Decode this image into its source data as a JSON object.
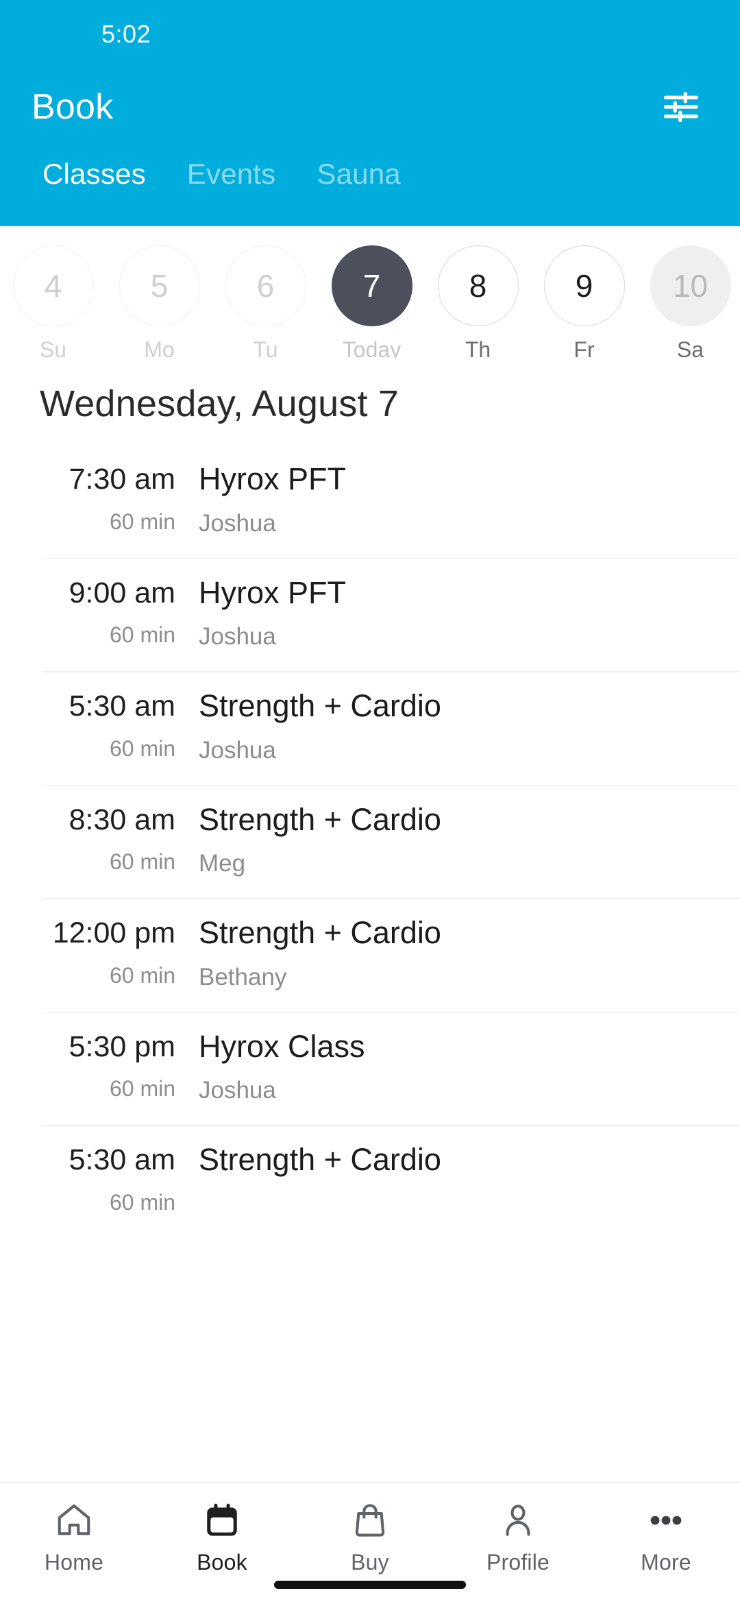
{
  "statusbar": {
    "time": "5:02"
  },
  "header": {
    "title": "Book",
    "accent_color": "#00ADDC",
    "filter_icon": "tune-icon",
    "tabs": [
      {
        "label": "Classes",
        "active": true
      },
      {
        "label": "Events",
        "active": false
      },
      {
        "label": "Sauna",
        "active": false
      }
    ]
  },
  "datestrip": {
    "days": [
      {
        "num": "4",
        "label": "Su",
        "state": "past"
      },
      {
        "num": "5",
        "label": "Mo",
        "state": "past"
      },
      {
        "num": "6",
        "label": "Tu",
        "state": "past"
      },
      {
        "num": "7",
        "label": "Today",
        "state": "today"
      },
      {
        "num": "8",
        "label": "Th",
        "state": "future"
      },
      {
        "num": "9",
        "label": "Fr",
        "state": "future"
      },
      {
        "num": "10",
        "label": "Sa",
        "state": "muted"
      }
    ],
    "selected_color": "#4D505A"
  },
  "schedule": {
    "day_heading": "Wednesday, August 7",
    "classes": [
      {
        "time": "7:30 am",
        "duration": "60 min",
        "name": "Hyrox PFT",
        "instructor": "Joshua"
      },
      {
        "time": "9:00 am",
        "duration": "60 min",
        "name": "Hyrox PFT",
        "instructor": "Joshua"
      },
      {
        "time": "5:30 am",
        "duration": "60 min",
        "name": "Strength + Cardio",
        "instructor": "Joshua"
      },
      {
        "time": "8:30 am",
        "duration": "60 min",
        "name": "Strength + Cardio",
        "instructor": "Meg"
      },
      {
        "time": "12:00 pm",
        "duration": "60 min",
        "name": "Strength + Cardio",
        "instructor": "Bethany"
      },
      {
        "time": "5:30 pm",
        "duration": "60 min",
        "name": "Hyrox Class",
        "instructor": "Joshua"
      },
      {
        "time": "5:30 am",
        "duration": "60 min",
        "name": "Strength + Cardio",
        "instructor": ""
      }
    ]
  },
  "bottomnav": {
    "items": [
      {
        "label": "Home",
        "icon": "home-icon",
        "active": false
      },
      {
        "label": "Book",
        "icon": "calendar-icon",
        "active": true
      },
      {
        "label": "Buy",
        "icon": "bag-icon",
        "active": false
      },
      {
        "label": "Profile",
        "icon": "person-icon",
        "active": false
      },
      {
        "label": "More",
        "icon": "ellipsis-icon",
        "active": false
      }
    ]
  }
}
